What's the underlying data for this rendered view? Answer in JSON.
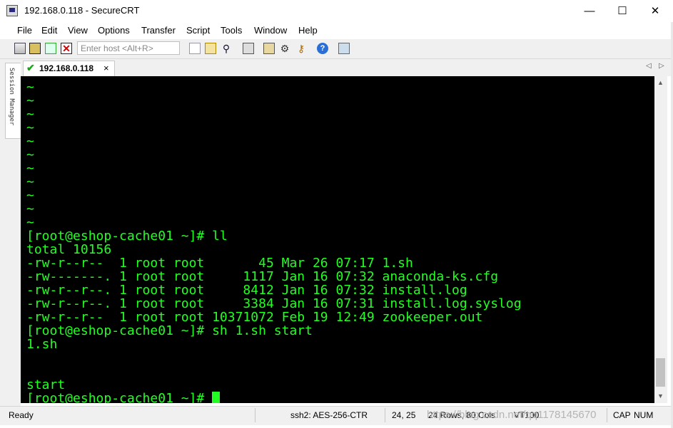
{
  "window": {
    "title": "192.168.0.118 - SecureCRT",
    "minimize": "—",
    "maximize": "☐",
    "close": "✕"
  },
  "menu": [
    "File",
    "Edit",
    "View",
    "Options",
    "Transfer",
    "Script",
    "Tools",
    "Window",
    "Help"
  ],
  "toolbar": {
    "quick_connect_placeholder": "Enter host <Alt+R>",
    "icons": [
      "connect-icon",
      "reconnect-icon",
      "disconnect-icon",
      "copy-icon",
      "paste-icon",
      "find-icon",
      "print-icon",
      "session-options-icon",
      "global-options-icon",
      "keymap-icon",
      "help-icon",
      "sftp-icon"
    ]
  },
  "sidebar": {
    "label": "Session Manager"
  },
  "tabs": [
    {
      "label": "192.168.0.118",
      "status": "connected",
      "close": "×"
    }
  ],
  "tab_nav": {
    "left": "◁",
    "right": "▷"
  },
  "terminal": {
    "fg_color": "#22ff22",
    "bg_color": "#000000",
    "lines": [
      "~",
      "~",
      "~",
      "~",
      "~",
      "~",
      "~",
      "~",
      "~",
      "~",
      "~",
      "[root@eshop-cache01 ~]# ll",
      "total 10156",
      "-rw-r--r--  1 root root       45 Mar 26 07:17 1.sh",
      "-rw-------. 1 root root     1117 Jan 16 07:32 anaconda-ks.cfg",
      "-rw-r--r--. 1 root root     8412 Jan 16 07:32 install.log",
      "-rw-r--r--. 1 root root     3384 Jan 16 07:31 install.log.syslog",
      "-rw-r--r--  1 root root 10371072 Feb 19 12:49 zookeeper.out",
      "[root@eshop-cache01 ~]# sh 1.sh start",
      "1.sh",
      "",
      "",
      "start"
    ],
    "prompt": "[root@eshop-cache01 ~]# "
  },
  "status": {
    "state": "Ready",
    "cipher": "ssh2: AES-256-CTR",
    "cursor_pos": "24,  25",
    "size": "24 Rows, 80 Cols",
    "emulation": "VT100",
    "cap": "CAP",
    "num": "NUM"
  },
  "watermark": "https://blog.csdn.net/qq1178145670"
}
